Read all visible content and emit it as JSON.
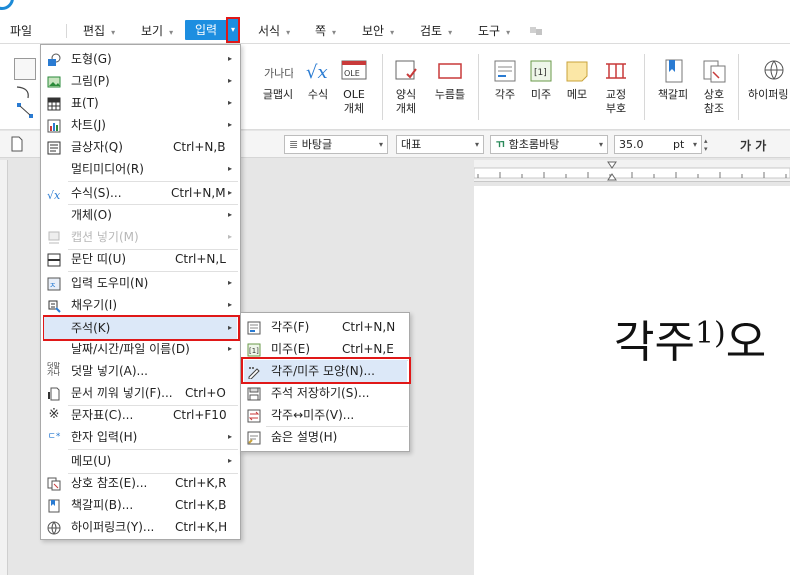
{
  "menubar": {
    "items": [
      {
        "label": "파일",
        "has_arrow": false
      },
      {
        "label": "편집",
        "has_arrow": true
      },
      {
        "label": "보기",
        "has_arrow": true
      },
      {
        "label": "입력",
        "has_arrow": true
      },
      {
        "label": "서식",
        "has_arrow": true
      },
      {
        "label": "쪽",
        "has_arrow": true
      },
      {
        "label": "보안",
        "has_arrow": true
      },
      {
        "label": "검토",
        "has_arrow": true
      },
      {
        "label": "도구",
        "has_arrow": true
      }
    ],
    "active": "입력",
    "accent_color": "#1d8ee0",
    "highlight_color": "#e01818"
  },
  "ribbon": {
    "buttons": [
      {
        "label": "글맵시",
        "sub": "",
        "icon": "wordart-icon"
      },
      {
        "label": "수식",
        "sub": "",
        "icon": "formula-icon"
      },
      {
        "label": "OLE",
        "sub": "개체",
        "icon": "ole-object-icon"
      },
      {
        "label": "양식",
        "sub": "개체",
        "icon": "form-object-icon"
      },
      {
        "label": "누름틀",
        "sub": "",
        "icon": "click-field-icon"
      },
      {
        "label": "각주",
        "sub": "",
        "icon": "footnote-icon"
      },
      {
        "label": "미주",
        "sub": "",
        "icon": "endnote-icon"
      },
      {
        "label": "메모",
        "sub": "",
        "icon": "memo-icon"
      },
      {
        "label": "교정",
        "sub": "부호",
        "icon": "proofreading-icon"
      },
      {
        "label": "책갈피",
        "sub": "",
        "icon": "bookmark-icon"
      },
      {
        "label": "상호",
        "sub": "참조",
        "icon": "cross-reference-icon"
      },
      {
        "label": "하이퍼링",
        "sub": "",
        "icon": "hyperlink-icon"
      }
    ],
    "icon_texts": {
      "wordart": "가나다",
      "ole": "OLE",
      "endnote": "[1]"
    }
  },
  "format_toolbar": {
    "style": "바탕글",
    "language": "대표",
    "font": "함초롬바탕",
    "size": "35.0",
    "size_unit": "pt",
    "font_glyph": "ㄲ",
    "right_glyphs": "가 가"
  },
  "document": {
    "text": "각주",
    "sup": "1)",
    "trail": "오"
  },
  "input_menu": {
    "items": [
      {
        "label": "도형(G)",
        "shortcut": "",
        "submenu": true,
        "icon": "shape-icon",
        "disabled": false
      },
      {
        "label": "그림(P)",
        "shortcut": "",
        "submenu": true,
        "icon": "picture-icon",
        "disabled": false
      },
      {
        "label": "표(T)",
        "shortcut": "",
        "submenu": true,
        "icon": "table-icon",
        "disabled": false
      },
      {
        "label": "차트(J)",
        "shortcut": "",
        "submenu": true,
        "icon": "chart-icon",
        "disabled": false
      },
      {
        "label": "글상자(Q)",
        "shortcut": "Ctrl+N,B",
        "submenu": false,
        "icon": "textbox-icon",
        "disabled": false
      },
      {
        "label": "멀티미디어(R)",
        "shortcut": "",
        "submenu": true,
        "icon": "",
        "disabled": false
      },
      {
        "label": "수식(S)...",
        "shortcut": "Ctrl+N,M",
        "submenu": true,
        "icon": "formula-icon",
        "disabled": false
      },
      {
        "label": "개체(O)",
        "shortcut": "",
        "submenu": true,
        "icon": "",
        "disabled": false
      },
      {
        "label": "캡션 넣기(M)",
        "shortcut": "",
        "submenu": true,
        "icon": "caption-icon",
        "disabled": true
      },
      {
        "label": "문단 띠(U)",
        "shortcut": "Ctrl+N,L",
        "submenu": false,
        "icon": "paragraph-band-icon",
        "disabled": false
      },
      {
        "label": "입력 도우미(N)",
        "shortcut": "",
        "submenu": true,
        "icon": "input-helper-icon",
        "disabled": false
      },
      {
        "label": "채우기(I)",
        "shortcut": "",
        "submenu": true,
        "icon": "fill-icon",
        "disabled": false
      },
      {
        "label": "주석(K)",
        "shortcut": "",
        "submenu": true,
        "icon": "",
        "disabled": false
      },
      {
        "label": "날짜/시간/파일 이름(D)",
        "shortcut": "",
        "submenu": true,
        "icon": "",
        "disabled": false
      },
      {
        "label": "덧말 넣기(A)...",
        "shortcut": "",
        "submenu": false,
        "icon": "ruby-text-icon",
        "disabled": false
      },
      {
        "label": "문서 끼워 넣기(F)...",
        "shortcut": "Ctrl+O",
        "submenu": false,
        "icon": "insert-document-icon",
        "disabled": false
      },
      {
        "label": "문자표(C)...",
        "shortcut": "Ctrl+F10",
        "submenu": false,
        "icon": "symbol-icon",
        "disabled": false
      },
      {
        "label": "한자 입력(H)",
        "shortcut": "",
        "submenu": true,
        "icon": "hanja-icon",
        "disabled": false
      },
      {
        "label": "메모(U)",
        "shortcut": "",
        "submenu": true,
        "icon": "",
        "disabled": false
      },
      {
        "label": "상호 참조(E)...",
        "shortcut": "Ctrl+K,R",
        "submenu": false,
        "icon": "cross-reference-icon",
        "disabled": false
      },
      {
        "label": "책갈피(B)...",
        "shortcut": "Ctrl+K,B",
        "submenu": false,
        "icon": "bookmark-icon",
        "disabled": false
      },
      {
        "label": "하이퍼링크(Y)...",
        "shortcut": "Ctrl+K,H",
        "submenu": false,
        "icon": "hyperlink-icon",
        "disabled": false
      }
    ],
    "icon_texts": {
      "ruby": "덧말\n가나",
      "symbol": "※",
      "hanja": "ㄷ漢"
    }
  },
  "annotation_submenu": {
    "items": [
      {
        "label": "각주(F)",
        "shortcut": "Ctrl+N,N",
        "icon": "footnote-icon"
      },
      {
        "label": "미주(E)",
        "shortcut": "Ctrl+N,E",
        "icon": "endnote-icon"
      },
      {
        "label": "각주/미주 모양(N)...",
        "shortcut": "",
        "icon": "note-shape-icon"
      },
      {
        "label": "주석 저장하기(S)...",
        "shortcut": "",
        "icon": "save-notes-icon"
      },
      {
        "label": "각주↔미주(V)...",
        "shortcut": "",
        "icon": "swap-notes-icon"
      },
      {
        "label": "숨은 설명(H)",
        "shortcut": "",
        "icon": "hidden-comment-icon"
      }
    ]
  }
}
